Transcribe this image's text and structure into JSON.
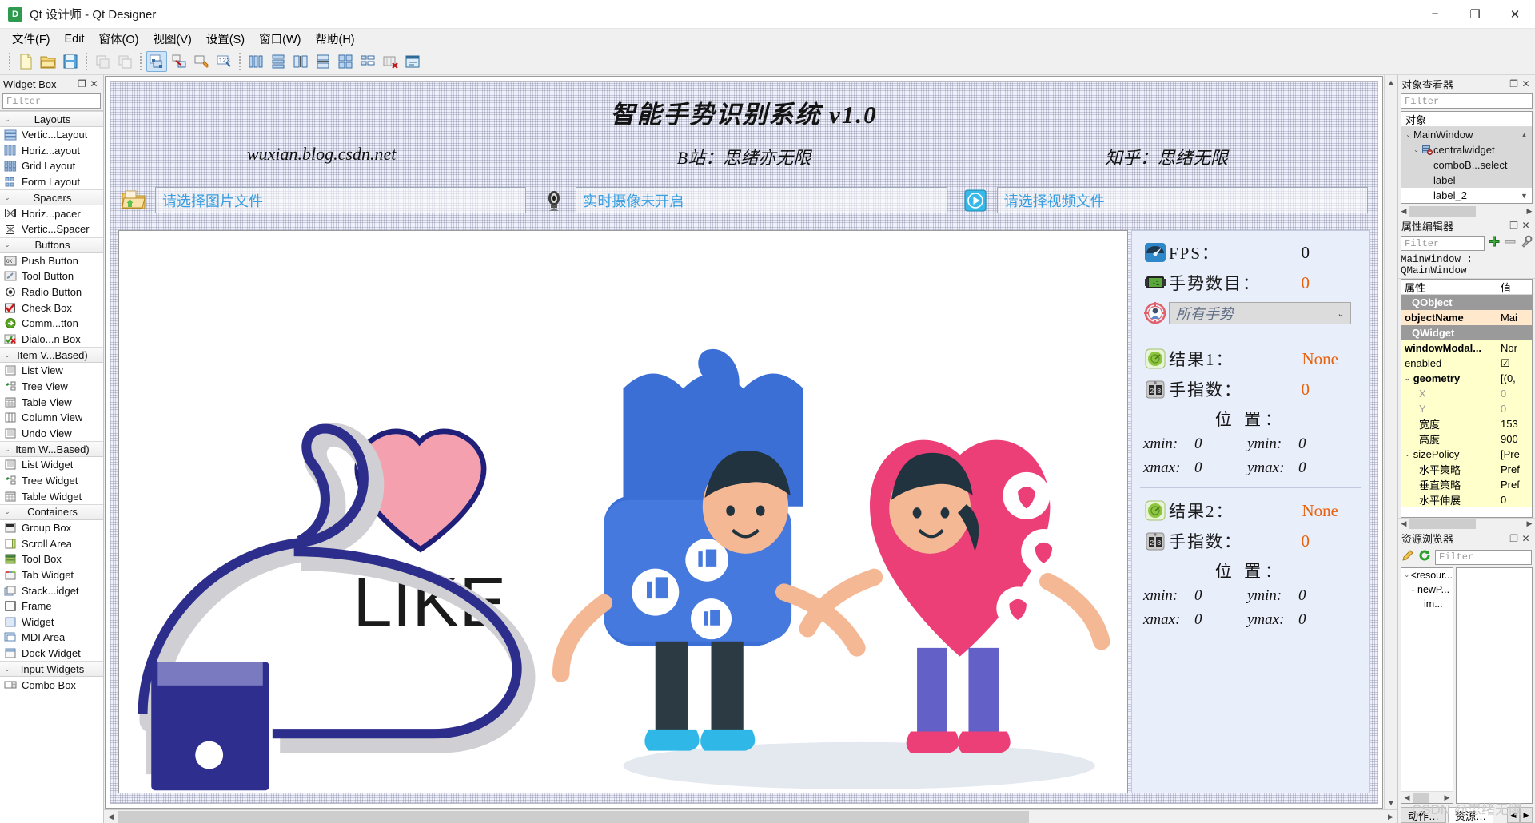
{
  "window": {
    "title": "Qt 设计师 - Qt Designer",
    "logo_letter": "D",
    "minimize": "−",
    "maximize": "❐",
    "close": "✕"
  },
  "menu": [
    {
      "label": "文件(F)"
    },
    {
      "label": "Edit"
    },
    {
      "label": "窗体(O)"
    },
    {
      "label": "视图(V)"
    },
    {
      "label": "设置(S)"
    },
    {
      "label": "窗口(W)"
    },
    {
      "label": "帮助(H)"
    }
  ],
  "toolbar": {
    "groups": [
      [
        "new-file-icon",
        "open-folder-icon",
        "save-icon"
      ],
      [
        "undo-icon",
        "redo-icon"
      ],
      [
        "edit-widgets-icon",
        "edit-signals-icon",
        "edit-buddies-icon",
        "edit-tab-order-icon"
      ],
      [
        "layout-horizontally-icon",
        "layout-vertically-icon",
        "layout-splitter-h-icon",
        "layout-splitter-v-icon",
        "layout-grid-icon",
        "layout-form-icon",
        "break-layout-icon",
        "adjust-size-icon"
      ]
    ]
  },
  "widget_box": {
    "title": "Widget Box",
    "filter_placeholder": "Filter",
    "float_icon": "❐",
    "close_icon": "✕",
    "categories": [
      {
        "name": "Layouts",
        "items": [
          {
            "label": "Vertic...Layout",
            "icon": "vertical-layout-icon"
          },
          {
            "label": "Horiz...ayout",
            "icon": "horizontal-layout-icon"
          },
          {
            "label": "Grid Layout",
            "icon": "grid-layout-icon"
          },
          {
            "label": "Form Layout",
            "icon": "form-layout-icon"
          }
        ]
      },
      {
        "name": "Spacers",
        "items": [
          {
            "label": "Horiz...pacer",
            "icon": "horizontal-spacer-icon"
          },
          {
            "label": "Vertic...Spacer",
            "icon": "vertical-spacer-icon"
          }
        ]
      },
      {
        "name": "Buttons",
        "items": [
          {
            "label": "Push Button",
            "icon": "push-button-icon"
          },
          {
            "label": "Tool Button",
            "icon": "tool-button-icon"
          },
          {
            "label": "Radio Button",
            "icon": "radio-button-icon"
          },
          {
            "label": "Check Box",
            "icon": "check-box-icon"
          },
          {
            "label": "Comm...tton",
            "icon": "command-link-button-icon"
          },
          {
            "label": "Dialo...n Box",
            "icon": "dialog-button-box-icon"
          }
        ]
      },
      {
        "name": "Item V...Based)",
        "items": [
          {
            "label": "List View",
            "icon": "list-view-icon"
          },
          {
            "label": "Tree View",
            "icon": "tree-view-icon"
          },
          {
            "label": "Table View",
            "icon": "table-view-icon"
          },
          {
            "label": "Column View",
            "icon": "column-view-icon"
          },
          {
            "label": "Undo View",
            "icon": "undo-view-icon"
          }
        ]
      },
      {
        "name": "Item W...Based)",
        "items": [
          {
            "label": "List Widget",
            "icon": "list-widget-icon"
          },
          {
            "label": "Tree Widget",
            "icon": "tree-widget-icon"
          },
          {
            "label": "Table Widget",
            "icon": "table-widget-icon"
          }
        ]
      },
      {
        "name": "Containers",
        "items": [
          {
            "label": "Group Box",
            "icon": "group-box-icon"
          },
          {
            "label": "Scroll Area",
            "icon": "scroll-area-icon"
          },
          {
            "label": "Tool Box",
            "icon": "tool-box-icon"
          },
          {
            "label": "Tab Widget",
            "icon": "tab-widget-icon"
          },
          {
            "label": "Stack...idget",
            "icon": "stacked-widget-icon"
          },
          {
            "label": "Frame",
            "icon": "frame-icon"
          },
          {
            "label": "Widget",
            "icon": "widget-icon"
          },
          {
            "label": "MDI Area",
            "icon": "mdi-area-icon"
          },
          {
            "label": "Dock Widget",
            "icon": "dock-widget-icon"
          }
        ]
      },
      {
        "name": "Input Widgets",
        "items": [
          {
            "label": "Combo Box",
            "icon": "combo-box-icon"
          }
        ]
      }
    ]
  },
  "form": {
    "title": "智能手势识别系统  v1.0",
    "links": [
      "wuxian.blog.csdn.net",
      "B站：思绪亦无限",
      "知乎：思绪无限"
    ],
    "file_row": [
      {
        "icon": "open-image-folder-icon",
        "value": "请选择图片文件"
      },
      {
        "icon": "webcam-icon",
        "value": "实时摄像未开启"
      },
      {
        "icon": "play-video-icon",
        "value": "请选择视频文件"
      }
    ],
    "panel": {
      "fps_label": "FPS：",
      "fps_value": "0",
      "fps_icon": "speedometer-icon",
      "count_label": "手势数目：",
      "count_value": "0",
      "count_icon": "counter-display-icon",
      "select_icon": "target-person-icon",
      "select_value": "所有手势",
      "position_label": "位 置：",
      "results": [
        {
          "result_icon": "radar-green-icon",
          "result_label": "结果1：",
          "result_value": "None",
          "fingers_icon": "digit-counter-icon",
          "fingers_label": "手指数：",
          "fingers_value": "0",
          "xmin_key": "xmin:",
          "xmin_value": "0",
          "ymin_key": "ymin:",
          "ymin_value": "0",
          "xmax_key": "xmax:",
          "xmax_value": "0",
          "ymax_key": "ymax:",
          "ymax_value": "0"
        },
        {
          "result_icon": "radar-green-icon",
          "result_label": "结果2：",
          "result_value": "None",
          "fingers_icon": "digit-counter-icon",
          "fingers_label": "手指数：",
          "fingers_value": "0",
          "xmin_key": "xmin:",
          "xmin_value": "0",
          "ymin_key": "ymin:",
          "ymin_value": "0",
          "xmax_key": "xmax:",
          "xmax_value": "0",
          "ymax_key": "ymax:",
          "ymax_value": "0"
        }
      ]
    },
    "artwork_caption": "LIKE"
  },
  "object_inspector": {
    "title": "对象查看器",
    "filter_placeholder": "Filter",
    "column_header": "对象",
    "float_icon": "❐",
    "close_icon": "✕",
    "rows": [
      {
        "label": "MainWindow",
        "depth": 0,
        "arrow": "⌄",
        "icon": "",
        "selected": true
      },
      {
        "label": "centralwidget",
        "depth": 1,
        "arrow": "⌄",
        "icon": "central-widget-icon",
        "selected": true
      },
      {
        "label": "comboB...select",
        "depth": 2,
        "arrow": "",
        "icon": "",
        "selected": true
      },
      {
        "label": "label",
        "depth": 2,
        "arrow": "",
        "icon": "",
        "selected": true
      },
      {
        "label": "label_2",
        "depth": 2,
        "arrow": "",
        "icon": "",
        "selected": false
      }
    ]
  },
  "property_editor": {
    "title": "属性编辑器",
    "filter_placeholder": "Filter",
    "add_icon": "plus-icon",
    "remove_icon": "minus-icon",
    "configure_icon": "wrench-icon",
    "float_icon": "❐",
    "close_icon": "✕",
    "object_line": "MainWindow : QMainWindow",
    "col_property": "属性",
    "col_value": "值",
    "rows": [
      {
        "key": "QObject",
        "value": "",
        "type": "group"
      },
      {
        "key": "objectName",
        "value": "Mai",
        "type": "peach",
        "bold": true
      },
      {
        "key": "QWidget",
        "value": "",
        "type": "group"
      },
      {
        "key": "windowModal...",
        "value": "Nor",
        "type": "yellow",
        "bold": true
      },
      {
        "key": "enabled",
        "value": "☑",
        "type": "yellow"
      },
      {
        "key": "geometry",
        "value": "[(0,",
        "type": "yellow",
        "bold": true,
        "arrow": "⌄"
      },
      {
        "key": "X",
        "value": "0",
        "type": "yellow",
        "indent": 2,
        "sub": true
      },
      {
        "key": "Y",
        "value": "0",
        "type": "yellow",
        "indent": 2,
        "sub": true
      },
      {
        "key": "宽度",
        "value": "153",
        "type": "yellow",
        "indent": 2
      },
      {
        "key": "高度",
        "value": "900",
        "type": "yellow",
        "indent": 2
      },
      {
        "key": "sizePolicy",
        "value": "[Pre",
        "type": "yellow",
        "arrow": "⌄"
      },
      {
        "key": "水平策略",
        "value": "Pref",
        "type": "yellow",
        "indent": 2
      },
      {
        "key": "垂直策略",
        "value": "Pref",
        "type": "yellow",
        "indent": 2
      },
      {
        "key": "水平伸展",
        "value": "0",
        "type": "yellow",
        "indent": 2
      }
    ]
  },
  "resource_browser": {
    "title": "资源浏览器",
    "filter_placeholder": "Filter",
    "edit_icon": "pencil-icon",
    "reload_icon": "reload-icon",
    "float_icon": "❐",
    "close_icon": "✕",
    "tree": [
      {
        "label": "<resour...",
        "depth": 0,
        "arrow": "⌄"
      },
      {
        "label": "newP...",
        "depth": 1,
        "arrow": "⌄"
      },
      {
        "label": "im...",
        "depth": 2,
        "arrow": ""
      }
    ],
    "tabs": [
      {
        "label": "动作…",
        "active": false
      },
      {
        "label": "资源…",
        "active": true
      }
    ],
    "nav_prev": "◀",
    "nav_next": "▶"
  },
  "watermark": "CSDN @思绪无限",
  "colors": {
    "accent_orange": "#e8610c",
    "link_blue": "#3a9fe0",
    "form_bg": "#eef1fb",
    "panel_bg": "#e9eefb"
  }
}
